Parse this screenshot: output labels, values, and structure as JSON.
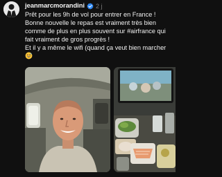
{
  "post": {
    "username": "jeanmarcmorandini",
    "timestamp": "2 j",
    "lines": [
      "Prêt pour les 9h de vol pour entrer en France !",
      "Bonne nouvelle le repas est vraiment très bien comme de plus en plus souvent sur #airfrance qui fait vraiment de gros progrès !",
      "Et il y a même le wifi (quand ça veut bien marcher"
    ]
  },
  "icons": {
    "verified": "verified-badge-icon",
    "emoji": "sweat-smile-emoji-icon"
  },
  "colors": {
    "background": "#101010",
    "verified_badge": "#2f89f5",
    "timestamp": "#7b7b7b"
  }
}
